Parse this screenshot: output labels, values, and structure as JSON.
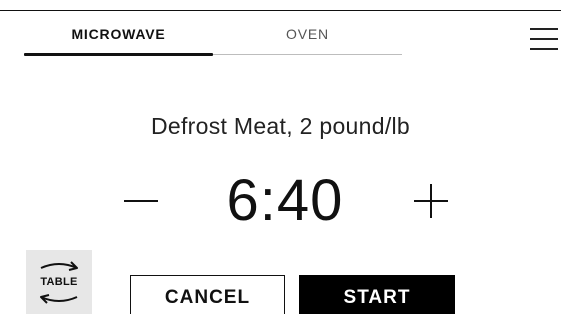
{
  "tabs": [
    {
      "label": "MICROWAVE",
      "active": true
    },
    {
      "label": "OVEN",
      "active": false
    }
  ],
  "menu": {
    "icon": "hamburger-menu-icon"
  },
  "program": {
    "title": "Defrost Meat, 2 pound/lb"
  },
  "timer": {
    "value": "6:40"
  },
  "controls": {
    "decrease_icon": "minus-icon",
    "increase_icon": "plus-icon"
  },
  "turntable": {
    "label": "TABLE",
    "icon": "turntable-rotate-icon"
  },
  "actions": {
    "cancel_label": "CANCEL",
    "start_label": "START"
  },
  "colors": {
    "accent": "#000000",
    "tab_inactive": "#555555",
    "table_button_bg": "#e7e7e7"
  }
}
